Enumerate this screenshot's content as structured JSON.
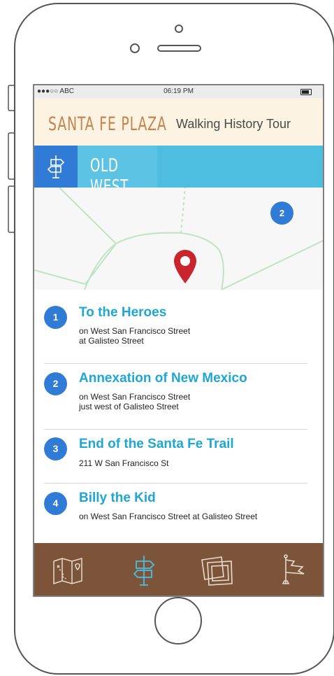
{
  "status_bar": {
    "carrier": "●●●○○ ABC",
    "time": "06:19 PM"
  },
  "header": {
    "title": "SANTA FE PLAZA",
    "subtitle": "Walking History Tour"
  },
  "section": {
    "title": "OLD WEST",
    "icon": "signpost-icon"
  },
  "map": {
    "marker_badge": "2",
    "pin_icon": "location-pin-icon"
  },
  "stops": [
    {
      "number": "1",
      "title": "To the Heroes",
      "address_line1": "on West San Francisco Street",
      "address_line2": "at Galisteo Street"
    },
    {
      "number": "2",
      "title": "Annexation of New Mexico",
      "address_line1": "on West San Francisco Street",
      "address_line2": "just west of Galisteo Street"
    },
    {
      "number": "3",
      "title": "End of the Santa Fe Trail",
      "address_line1": "211 W San Francisco St",
      "address_line2": ""
    },
    {
      "number": "4",
      "title": "Billy the Kid",
      "address_line1": "on West San Francisco Street at Galisteo Street",
      "address_line2": ""
    }
  ],
  "tabs": [
    {
      "icon": "map-icon",
      "active": false
    },
    {
      "icon": "signpost-icon",
      "active": true
    },
    {
      "icon": "photos-icon",
      "active": false
    },
    {
      "icon": "flag-icon",
      "active": false
    }
  ],
  "colors": {
    "accent_blue": "#2f7bd5",
    "title_blue": "#1ea6d4",
    "tabbar_brown": "#7b5439",
    "header_tan": "#c6834d"
  }
}
